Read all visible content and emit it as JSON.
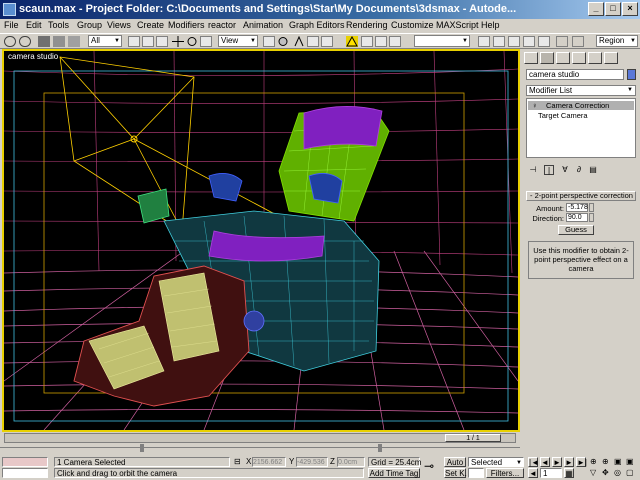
{
  "window": {
    "title": "scaun.max   - Project Folder: C:\\Documents and Settings\\Star\\My Documents\\3dsmax   - Autode...",
    "min_label": "_",
    "max_label": "□",
    "close_label": "×"
  },
  "menu": [
    "File",
    "Edit",
    "Tools",
    "Group",
    "Views",
    "Create",
    "Modifiers",
    "reactor",
    "Animation",
    "Graph Editors",
    "Rendering",
    "Customize",
    "MAXScript",
    "Help"
  ],
  "toolbar": {
    "selection_filter": "All",
    "ref_coord": "View",
    "named_selection": "",
    "render_type": "Region"
  },
  "viewport": {
    "label": "camera studio"
  },
  "command_panel": {
    "object_name": "camera studio",
    "modifier_list": "Modifier List",
    "stack": [
      "Camera Correction",
      "Target Camera"
    ],
    "rollout_title": "2-point perspective correction",
    "amount_label": "Amount:",
    "amount_value": "-5.178",
    "direction_label": "Direction:",
    "direction_value": "90.0",
    "guess_label": "Guess",
    "help_text": "Use this modifier to obtain 2-point perspective effect on a camera"
  },
  "time": {
    "slider_label": "1 / 1",
    "frame_progress": 1.0
  },
  "status": {
    "selection_info": "1 Camera Selected",
    "prompt": "Click and drag to orbit the camera",
    "x_label": "X",
    "x_value": "2156.662",
    "y_label": "Y",
    "y_value": "-429.536",
    "z_label": "Z",
    "z_value": "0.0cm",
    "grid": "Grid = 25.4cm",
    "add_time_tag": "Add Time Tag",
    "auto_key": "Auto",
    "set_key": "Set K.",
    "key_mode": "Selected",
    "filters": "Filters...",
    "current_frame": "1"
  },
  "colors": {
    "viewport_border": "#e8d000",
    "floor_grid": "#d060a0",
    "chair_back": "#80e000",
    "chair_body": "#40d0e0",
    "chair_pillow": "#b040e0",
    "front_chair_shell": "#e05050",
    "front_chair_cushion": "#f0f0a0",
    "camera": "#ffd000"
  }
}
